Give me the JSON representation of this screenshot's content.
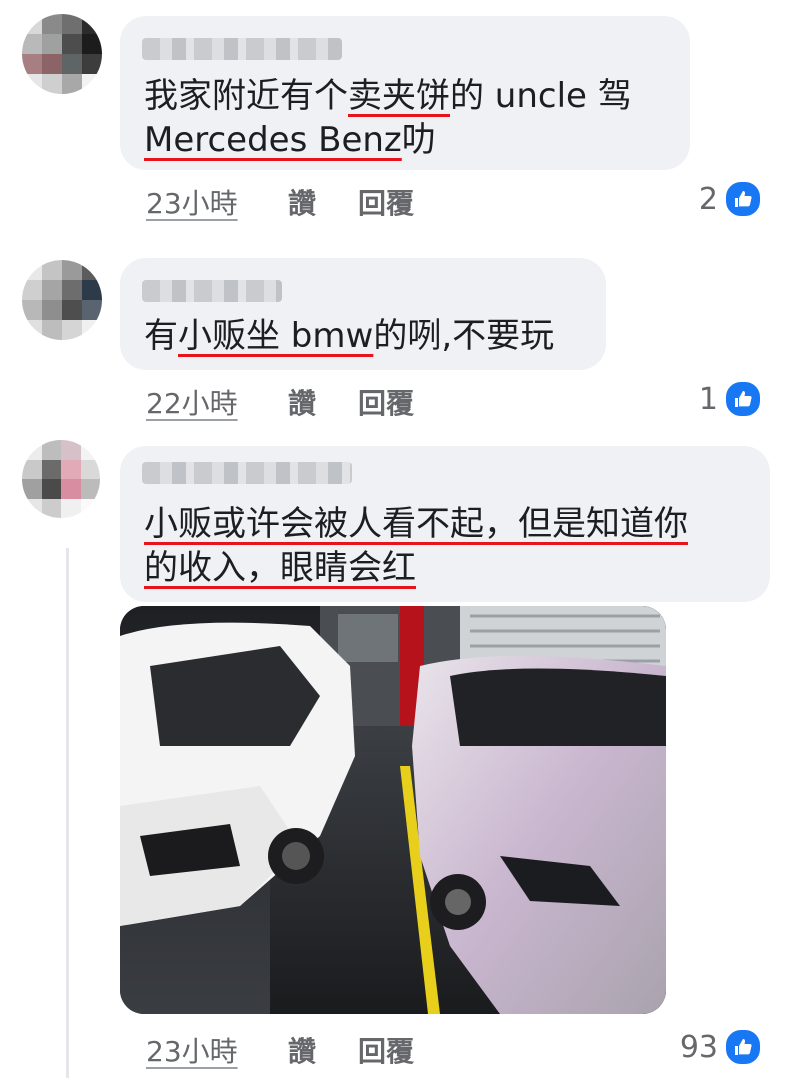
{
  "comments": [
    {
      "text_parts": [
        "我家附近有个",
        "卖夹饼",
        "的 uncle 驾"
      ],
      "line2_parts": [
        "Mercedes Benz",
        "叻"
      ],
      "time": "23小時",
      "like": "讚",
      "reply": "回覆",
      "reaction_count": "2"
    },
    {
      "text_parts": [
        "有",
        "小贩坐 bmw",
        "的咧,不要玩"
      ],
      "time": "22小時",
      "like": "讚",
      "reply": "回覆",
      "reaction_count": "1"
    },
    {
      "line1": "小贩或许会被人看不起，但是知道你",
      "line2_parts": [
        "的收入，眼睛会红"
      ],
      "time": "23小時",
      "like": "讚",
      "reply": "回覆",
      "reaction_count": "93"
    }
  ],
  "icons": {
    "reaction": "like-thumbs-up-icon"
  },
  "colors": {
    "accent": "#1877f2",
    "underline": "#e8141b",
    "bubble": "#eff1f4",
    "meta": "#65676b"
  }
}
